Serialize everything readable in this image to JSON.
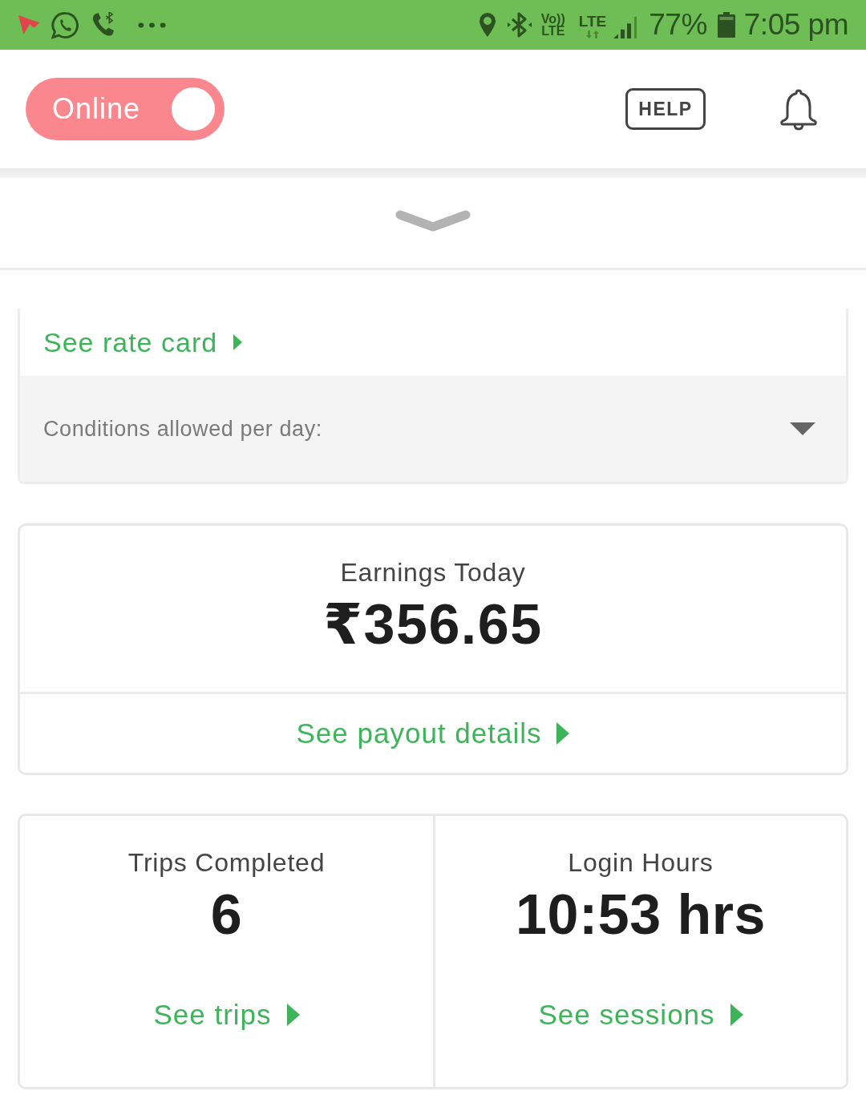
{
  "status_bar": {
    "volte_lines": [
      "Vo))",
      "LTE"
    ],
    "network": "LTE",
    "battery_percent": "77%",
    "time": "7:05 pm"
  },
  "header": {
    "status_toggle": {
      "label": "Online",
      "on": true
    },
    "help_button": "HELP"
  },
  "rate_card": {
    "link": "See rate card",
    "conditions": {
      "label": "Conditions allowed per day:",
      "expanded": false
    }
  },
  "earnings": {
    "title": "Earnings Today",
    "amount": "₹356.65",
    "link": "See payout details"
  },
  "stats": [
    {
      "title": "Trips Completed",
      "value": "6",
      "link": "See trips"
    },
    {
      "title": "Login Hours",
      "value": "10:53 hrs",
      "link": "See sessions"
    }
  ]
}
